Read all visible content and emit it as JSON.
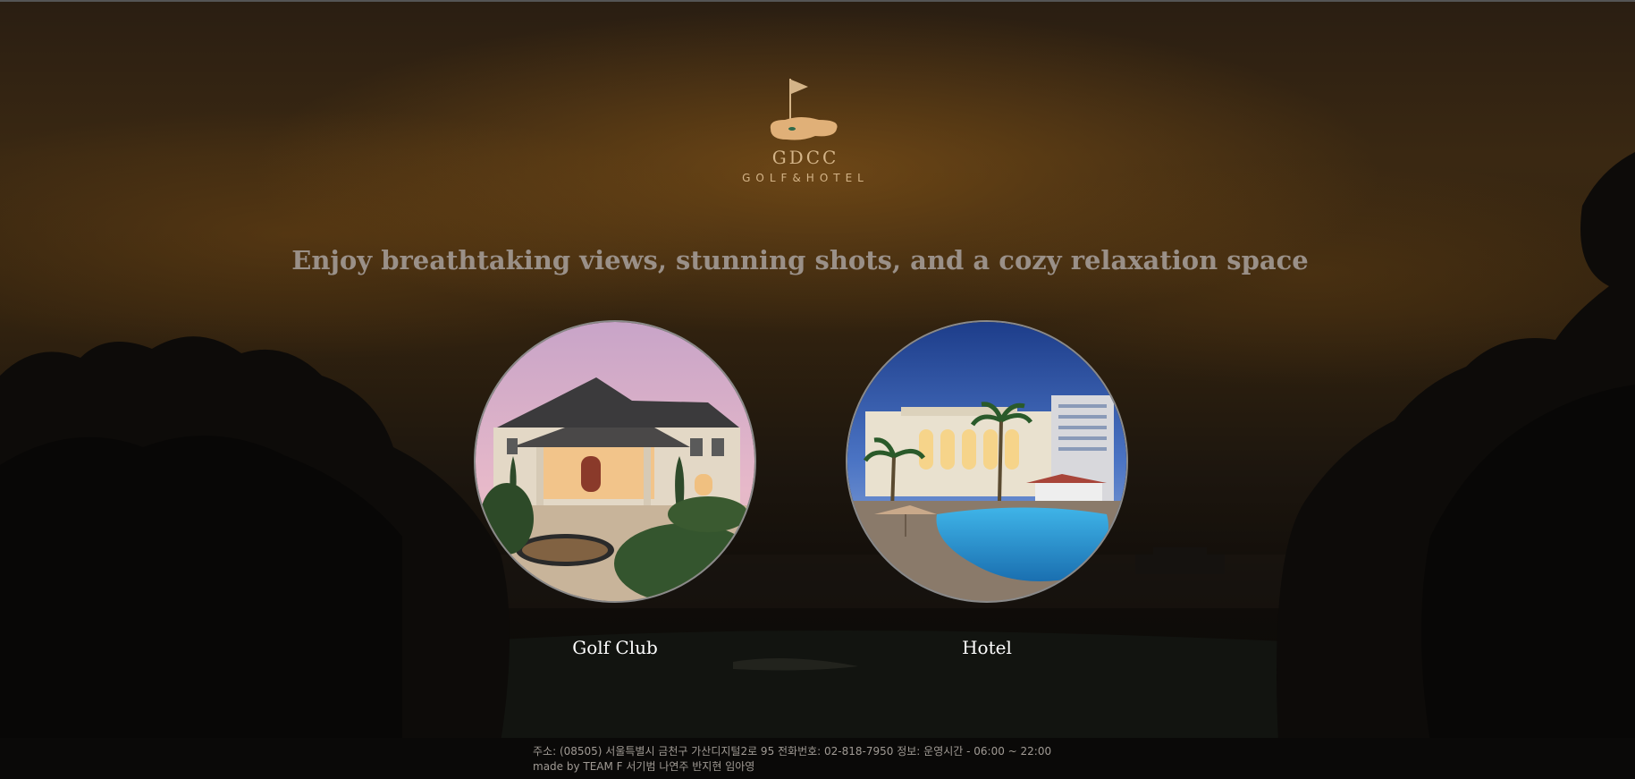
{
  "logo": {
    "name": "GDCC",
    "subtitle": "GOLF&HOTEL"
  },
  "tagline": "Enjoy breathtaking views, stunning shots, and a cozy relaxation space",
  "cards": [
    {
      "label": "Golf Club"
    },
    {
      "label": "Hotel"
    }
  ],
  "footer": {
    "address_line": "주소: (08505) 서울특별시 금천구 가산디지털2로 95 전화번호: 02-818-7950 정보: 운영시간 - 06:00 ~ 22:00",
    "credits_line": "made by TEAM F 서기범 나연주 반지현 임아영"
  },
  "colors": {
    "accent": "#d4b488",
    "tagline": "#9a9088",
    "label": "#ffffff"
  }
}
